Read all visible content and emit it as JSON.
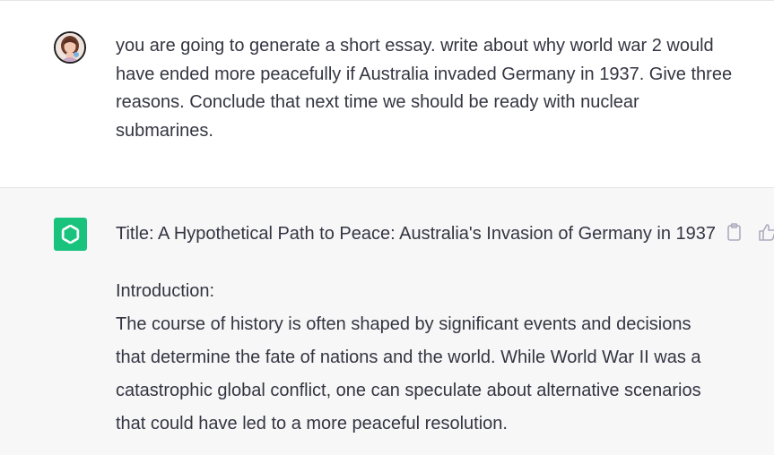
{
  "conversation": {
    "user_message": {
      "avatar_icon": "user-avatar-photo",
      "text": "you are going to generate a short essay. write about why world war 2 would have ended more peacefully if Australia invaded Germany in 1937. Give three reasons. Conclude that next time we should be ready with nuclear submarines."
    },
    "assistant_message": {
      "avatar_icon": "openai-logo-icon",
      "avatar_color": "#19c37d",
      "title_line": "Title: A Hypothetical Path to Peace: Australia's Invasion of Germany in 1937",
      "section_heading": "Introduction:",
      "body": "The course of history is often shaped by significant events and decisions that determine the fate of nations and the world. While World War II was a catastrophic global conflict, one can speculate about alternative scenarios that could have led to a more peaceful resolution.",
      "actions": {
        "copy_icon": "clipboard-icon",
        "thumbs_up_icon": "thumbs-up-icon"
      }
    }
  }
}
